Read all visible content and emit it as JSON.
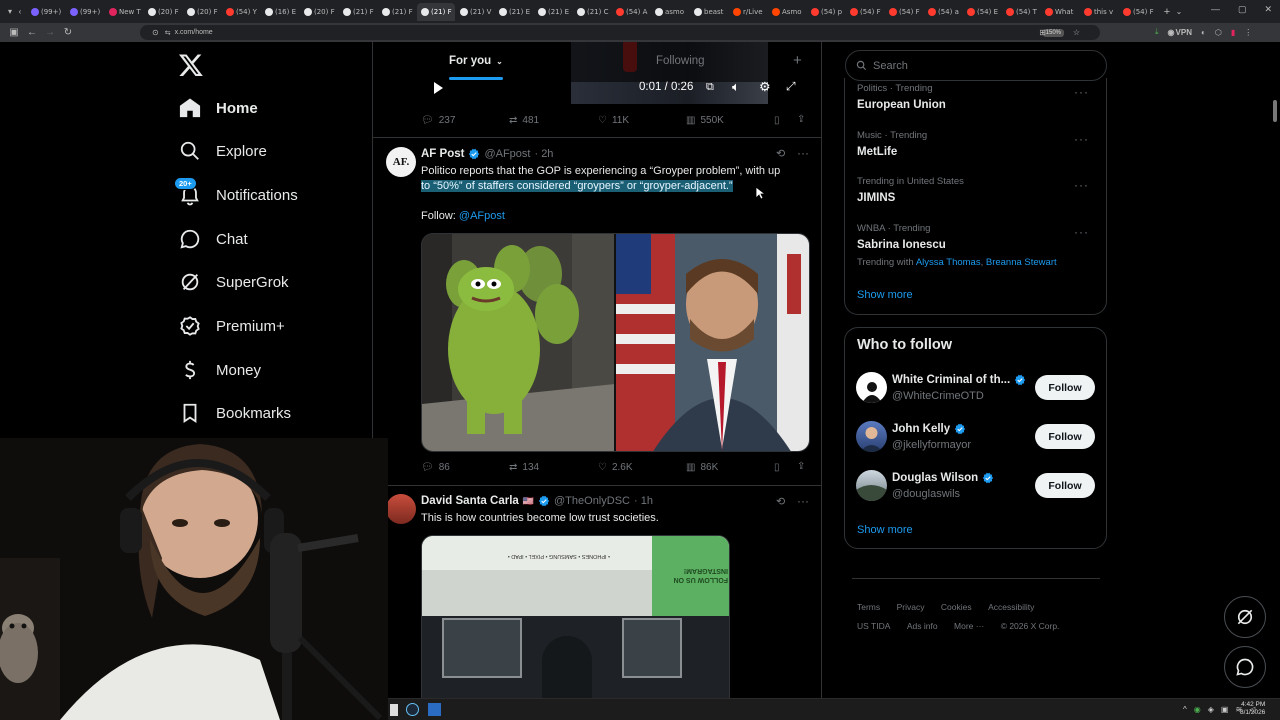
{
  "browser": {
    "tabs": [
      {
        "label": "(99+)",
        "color": "#7b61ff"
      },
      {
        "label": "(99+)",
        "color": "#7b61ff"
      },
      {
        "label": "New T",
        "color": "#e0245e"
      },
      {
        "label": "(20) F",
        "color": "#e7e9ea"
      },
      {
        "label": "(20) F",
        "color": "#e7e9ea"
      },
      {
        "label": "(54) Y",
        "color": "#ff3b30"
      },
      {
        "label": "(16) E",
        "color": "#e7e9ea"
      },
      {
        "label": "(20) F",
        "color": "#e7e9ea"
      },
      {
        "label": "(21) F",
        "color": "#e7e9ea"
      },
      {
        "label": "(21) F",
        "color": "#e7e9ea"
      },
      {
        "label": "(21) F",
        "color": "#e7e9ea",
        "active": true
      },
      {
        "label": "(21) V",
        "color": "#e7e9ea"
      },
      {
        "label": "(21) E",
        "color": "#e7e9ea"
      },
      {
        "label": "(21) E",
        "color": "#e7e9ea"
      },
      {
        "label": "(21) C",
        "color": "#e7e9ea"
      },
      {
        "label": "(54) A",
        "color": "#ff3b30"
      },
      {
        "label": "asmo",
        "color": "#e7e9ea"
      },
      {
        "label": "beast",
        "color": "#e7e9ea"
      },
      {
        "label": "r/Live",
        "color": "#ff4500"
      },
      {
        "label": "Asmo",
        "color": "#ff4500"
      },
      {
        "label": "(54) p",
        "color": "#ff3b30"
      },
      {
        "label": "(54) F",
        "color": "#ff3b30"
      },
      {
        "label": "(54) F",
        "color": "#ff3b30"
      },
      {
        "label": "(54) a",
        "color": "#ff3b30"
      },
      {
        "label": "(54) E",
        "color": "#ff3b30"
      },
      {
        "label": "(54) T",
        "color": "#ff3b30"
      },
      {
        "label": "What",
        "color": "#ff3b30"
      },
      {
        "label": "this v",
        "color": "#ff3b30"
      },
      {
        "label": "(54) F",
        "color": "#ff3b30"
      }
    ],
    "url": "x.com/home",
    "zoom": "150%",
    "vpn": "VPN"
  },
  "nav": {
    "logo": "X",
    "items": [
      {
        "key": "home",
        "label": "Home",
        "icon": "home-icon"
      },
      {
        "key": "explore",
        "label": "Explore",
        "icon": "search-icon"
      },
      {
        "key": "notifications",
        "label": "Notifications",
        "icon": "bell-icon",
        "badge": "20+"
      },
      {
        "key": "chat",
        "label": "Chat",
        "icon": "chat-icon"
      },
      {
        "key": "supergrok",
        "label": "SuperGrok",
        "icon": "grok-icon"
      },
      {
        "key": "premium",
        "label": "Premium+",
        "icon": "premium-icon"
      },
      {
        "key": "money",
        "label": "Money",
        "icon": "money-icon"
      },
      {
        "key": "bookmarks",
        "label": "Bookmarks",
        "icon": "bookmark-icon"
      }
    ]
  },
  "timeline": {
    "tabs": {
      "for_you": "For you",
      "following": "Following"
    },
    "video": {
      "time": "0:01 / 0:26"
    },
    "first_actions": {
      "replies": "237",
      "reposts": "481",
      "likes": "11K",
      "views": "550K"
    },
    "tweet1": {
      "name": "AF Post",
      "handle": "@AFpost",
      "time": "· 2h",
      "avatar_text": "AF.",
      "text_line1": "Politico reports that the GOP is experiencing a “Groyper problem”, with up",
      "text_highlight": "to “50%” of staffers considered “groypers” or “groyper-adjacent.”",
      "follow_prefix": "Follow:",
      "follow_handle": "@AFpost",
      "actions": {
        "replies": "86",
        "reposts": "134",
        "likes": "2.6K",
        "views": "86K"
      }
    },
    "tweet2": {
      "name": "David Santa Carla",
      "flag": "🇺🇸",
      "handle": "@TheOnlyDSC",
      "time": "· 1h",
      "text": "This is how countries become low trust societies.",
      "image_sign": "• IPHONES • SAMSUNG • PIXEL • IPAD •",
      "image_sign2": "FOLLOW US ON INSTAGRAM!"
    }
  },
  "right": {
    "search_placeholder": "Search",
    "trends": [
      {
        "meta": "Politics · Trending",
        "title": "European Union"
      },
      {
        "meta": "Music · Trending",
        "title": "MetLife"
      },
      {
        "meta": "Trending in United States",
        "title": "JIMINS"
      },
      {
        "meta": "WNBA · Trending",
        "title": "Sabrina Ionescu",
        "with_prefix": "Trending with",
        "with_a": "Alyssa Thomas",
        "with_sep": ",",
        "with_b": "Breanna Stewart"
      }
    ],
    "show_more": "Show more",
    "who_title": "Who to follow",
    "follows": [
      {
        "name": "White Criminal of th...",
        "handle": "@WhiteCrimeOTD",
        "button": "Follow"
      },
      {
        "name": "John Kelly",
        "handle": "@jkellyformayor",
        "button": "Follow"
      },
      {
        "name": "Douglas Wilson",
        "handle": "@douglaswils",
        "button": "Follow"
      }
    ],
    "show_more2": "Show more",
    "footer": [
      "Terms",
      "Privacy",
      "Cookies",
      "Accessibility",
      "US TIDA",
      "Ads info",
      "More ···",
      "© 2026 X Corp."
    ]
  },
  "taskbar": {
    "time": "4:42 PM",
    "date": "8/1/2026"
  },
  "colors": {
    "accent": "#1d9bf0",
    "highlight": "#1b5f74"
  }
}
